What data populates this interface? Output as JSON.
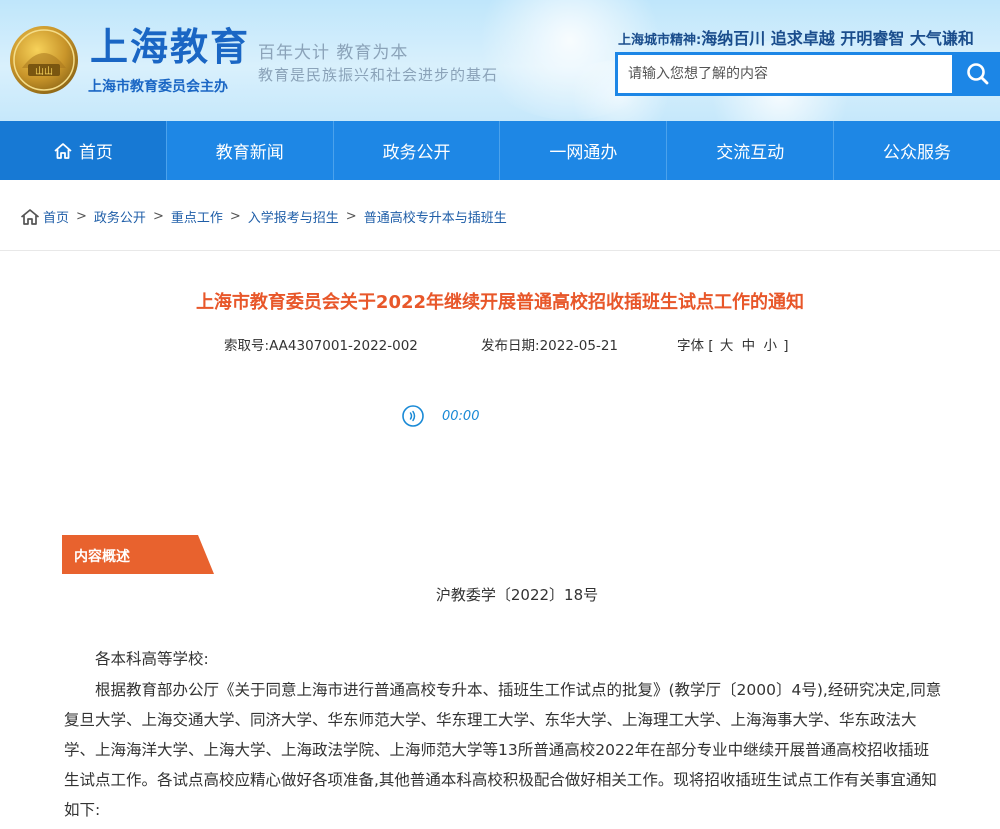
{
  "site": {
    "title": "上海教育",
    "subtitle": "上海市教育委员会主办",
    "logo_text": "山山",
    "slogan_line1": "百年大计 教育为本",
    "slogan_line2": "教育是民族振兴和社会进步的基石",
    "spirit_label": "上海城市精神:",
    "spirit_value": "海纳百川 追求卓越 开明睿智 大气谦和"
  },
  "search": {
    "placeholder": "请输入您想了解的内容",
    "icon": "search-icon"
  },
  "nav": {
    "items": [
      {
        "label": "首页"
      },
      {
        "label": "教育新闻"
      },
      {
        "label": "政务公开"
      },
      {
        "label": "一网通办"
      },
      {
        "label": "交流互动"
      },
      {
        "label": "公众服务"
      }
    ]
  },
  "breadcrumb": {
    "items": [
      "首页",
      "政务公开",
      "重点工作",
      "入学报考与招生",
      "普通高校专升本与插班生"
    ],
    "separator": ">"
  },
  "article": {
    "title": "上海市教育委员会关于2022年继续开展普通高校招收插班生试点工作的通知",
    "index_label": "索取号:",
    "index_value": "AA4307001-2022-002",
    "date_label": "发布日期:",
    "date_value": "2022-05-21",
    "font_label": "字体",
    "font_open": "[",
    "font_large": "大",
    "font_medium": "中",
    "font_small": "小",
    "font_close": "]",
    "audio_time": "00:00",
    "summary_tag": "内容概述",
    "doc_number": "沪教委学〔2022〕18号",
    "greeting": "各本科高等学校:",
    "paragraph1": "根据教育部办公厅《关于同意上海市进行普通高校专升本、插班生工作试点的批复》(教学厅〔2000〕4号),经研究决定,同意复旦大学、上海交通大学、同济大学、华东师范大学、华东理工大学、东华大学、上海理工大学、上海海事大学、华东政法大学、上海海洋大学、上海大学、上海政法学院、上海师范大学等13所普通高校2022年在部分专业中继续开展普通高校招收插班生试点工作。各试点高校应精心做好各项准备,其他普通本科高校积极配合做好相关工作。现将招收插班生试点工作有关事宜通知如下:"
  },
  "colors": {
    "nav_bg": "#1e87e5",
    "title_orange": "#e8572a",
    "tag_orange": "#e8622e",
    "link_blue": "#1f5ea8",
    "brand_blue": "#1a66c4"
  }
}
